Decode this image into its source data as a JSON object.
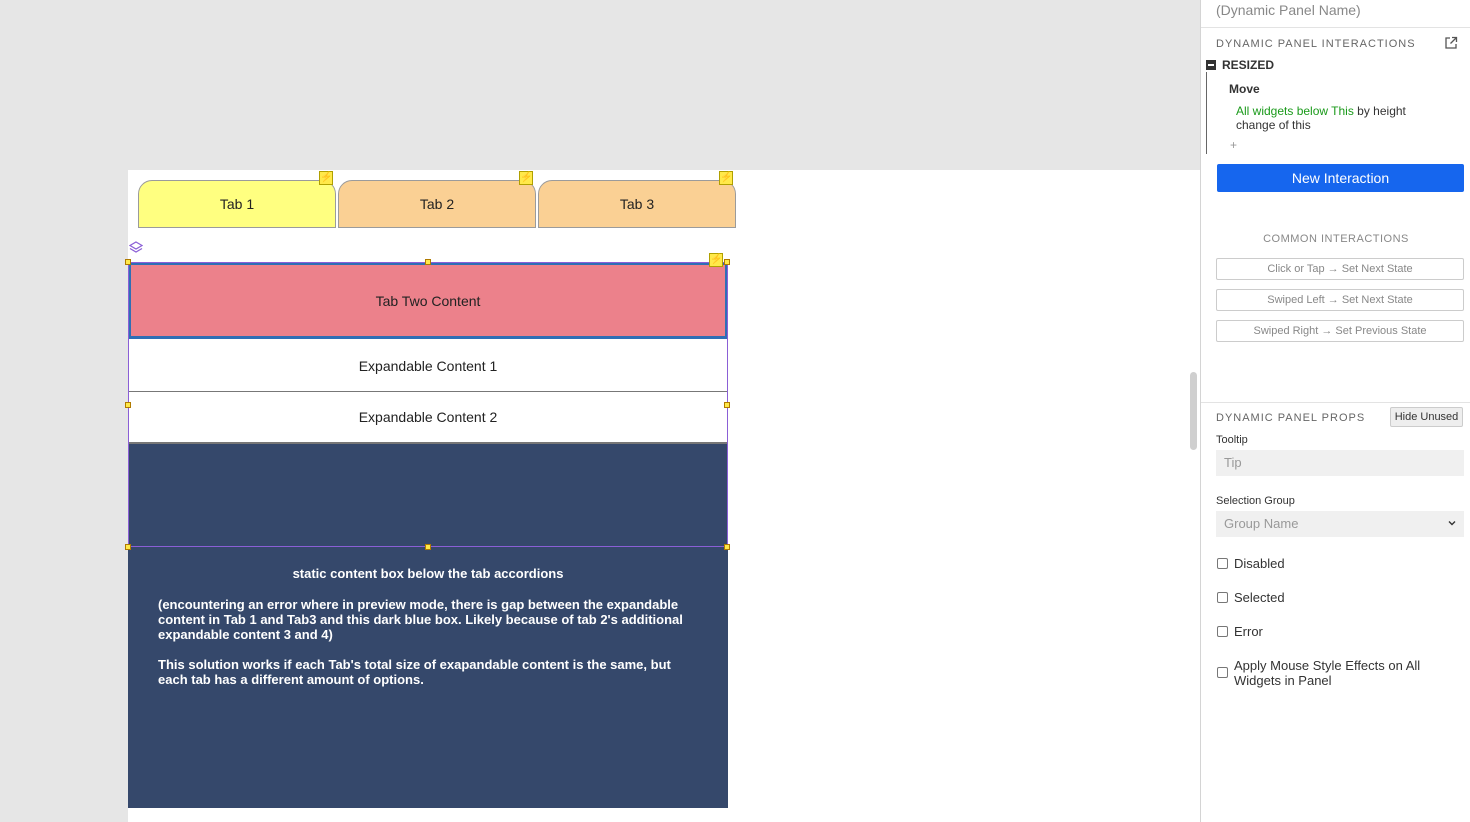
{
  "canvas": {
    "tabs": [
      {
        "label": "Tab 1"
      },
      {
        "label": "Tab 2"
      },
      {
        "label": "Tab 3"
      }
    ],
    "tab_two_content": "Tab Two Content",
    "expandable_1": "Expandable Content 1",
    "expandable_2": "Expandable Content 2",
    "static_title": "static content box below the tab accordions",
    "static_para_1": "(encountering an error where in preview mode, there is gap between the expandable content in Tab 1 and Tab3 and this dark blue box. Likely because of tab 2's additional expandable content 3 and 4)",
    "static_para_2": "This solution works if each Tab's total size of exapandable content is the same, but each tab has a different amount of options.",
    "colors": {
      "tab_active": "#ffff80",
      "tab_inactive": "#fad094",
      "tab_two_bg": "#ec818b",
      "dark_box": "#35486b",
      "selection": "#2f6eb5"
    },
    "icons": [
      "lightning-icon",
      "layers-icon"
    ]
  },
  "panel": {
    "name_placeholder": "(Dynamic Panel Name)",
    "interactions_header": "DYNAMIC PANEL INTERACTIONS",
    "event_name": "RESIZED",
    "action_name": "Move",
    "action_target": "All widgets below This",
    "action_rest": " by height change of this",
    "add_action": "+",
    "new_interaction": "New Interaction",
    "common_header": "COMMON INTERACTIONS",
    "common": [
      "Click or Tap → Set Next State",
      "Swiped Left → Set Next State",
      "Swiped Right → Set Previous State"
    ],
    "props_header": "DYNAMIC PANEL PROPS",
    "hide_unused": "Hide Unused",
    "tooltip_label": "Tooltip",
    "tooltip_placeholder": "Tip",
    "selection_group_label": "Selection Group",
    "selection_group_placeholder": "Group Name",
    "checkboxes": [
      "Disabled",
      "Selected",
      "Error",
      "Apply Mouse Style Effects on All Widgets in Panel"
    ],
    "accent": "#1666ee"
  }
}
